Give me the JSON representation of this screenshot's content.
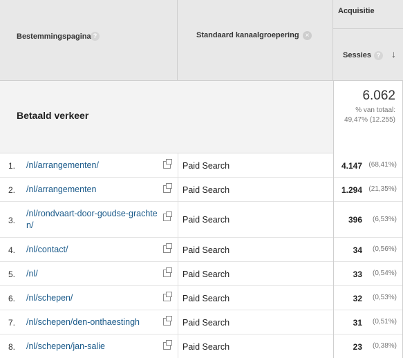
{
  "header": {
    "landing_page_label": "Bestemmingspagina",
    "help_icon": "?",
    "channel_label": "Standaard kanaalgroepering",
    "remove_icon": "×",
    "group_label": "Acquisitie",
    "sessions_label": "Sessies",
    "sort_icon": "↓"
  },
  "summary": {
    "label": "Betaald verkeer",
    "total": "6.062",
    "pct_label": "% van totaal:",
    "pct_value": "49,47% (12.255)"
  },
  "rows": [
    {
      "idx": "1.",
      "page": "/nl/arrangementen/",
      "channel": "Paid Search",
      "sessions": "4.147",
      "share": "(68,41%)"
    },
    {
      "idx": "2.",
      "page": "/nl/arrangementen",
      "channel": "Paid Search",
      "sessions": "1.294",
      "share": "(21,35%)"
    },
    {
      "idx": "3.",
      "page": "/nl/rondvaart-door-goudse-grachten/",
      "channel": "Paid Search",
      "sessions": "396",
      "share": "(6,53%)"
    },
    {
      "idx": "4.",
      "page": "/nl/contact/",
      "channel": "Paid Search",
      "sessions": "34",
      "share": "(0,56%)"
    },
    {
      "idx": "5.",
      "page": "/nl/",
      "channel": "Paid Search",
      "sessions": "33",
      "share": "(0,54%)"
    },
    {
      "idx": "6.",
      "page": "/nl/schepen/",
      "channel": "Paid Search",
      "sessions": "32",
      "share": "(0,53%)"
    },
    {
      "idx": "7.",
      "page": "/nl/schepen/den-onthaestingh",
      "channel": "Paid Search",
      "sessions": "31",
      "share": "(0,51%)"
    },
    {
      "idx": "8.",
      "page": "/nl/schepen/jan-salie",
      "channel": "Paid Search",
      "sessions": "23",
      "share": "(0,38%)"
    }
  ],
  "icons": {
    "help": "help-icon",
    "remove": "remove-dimension-icon",
    "sort": "sort-descending-icon",
    "external": "external-link-icon"
  }
}
